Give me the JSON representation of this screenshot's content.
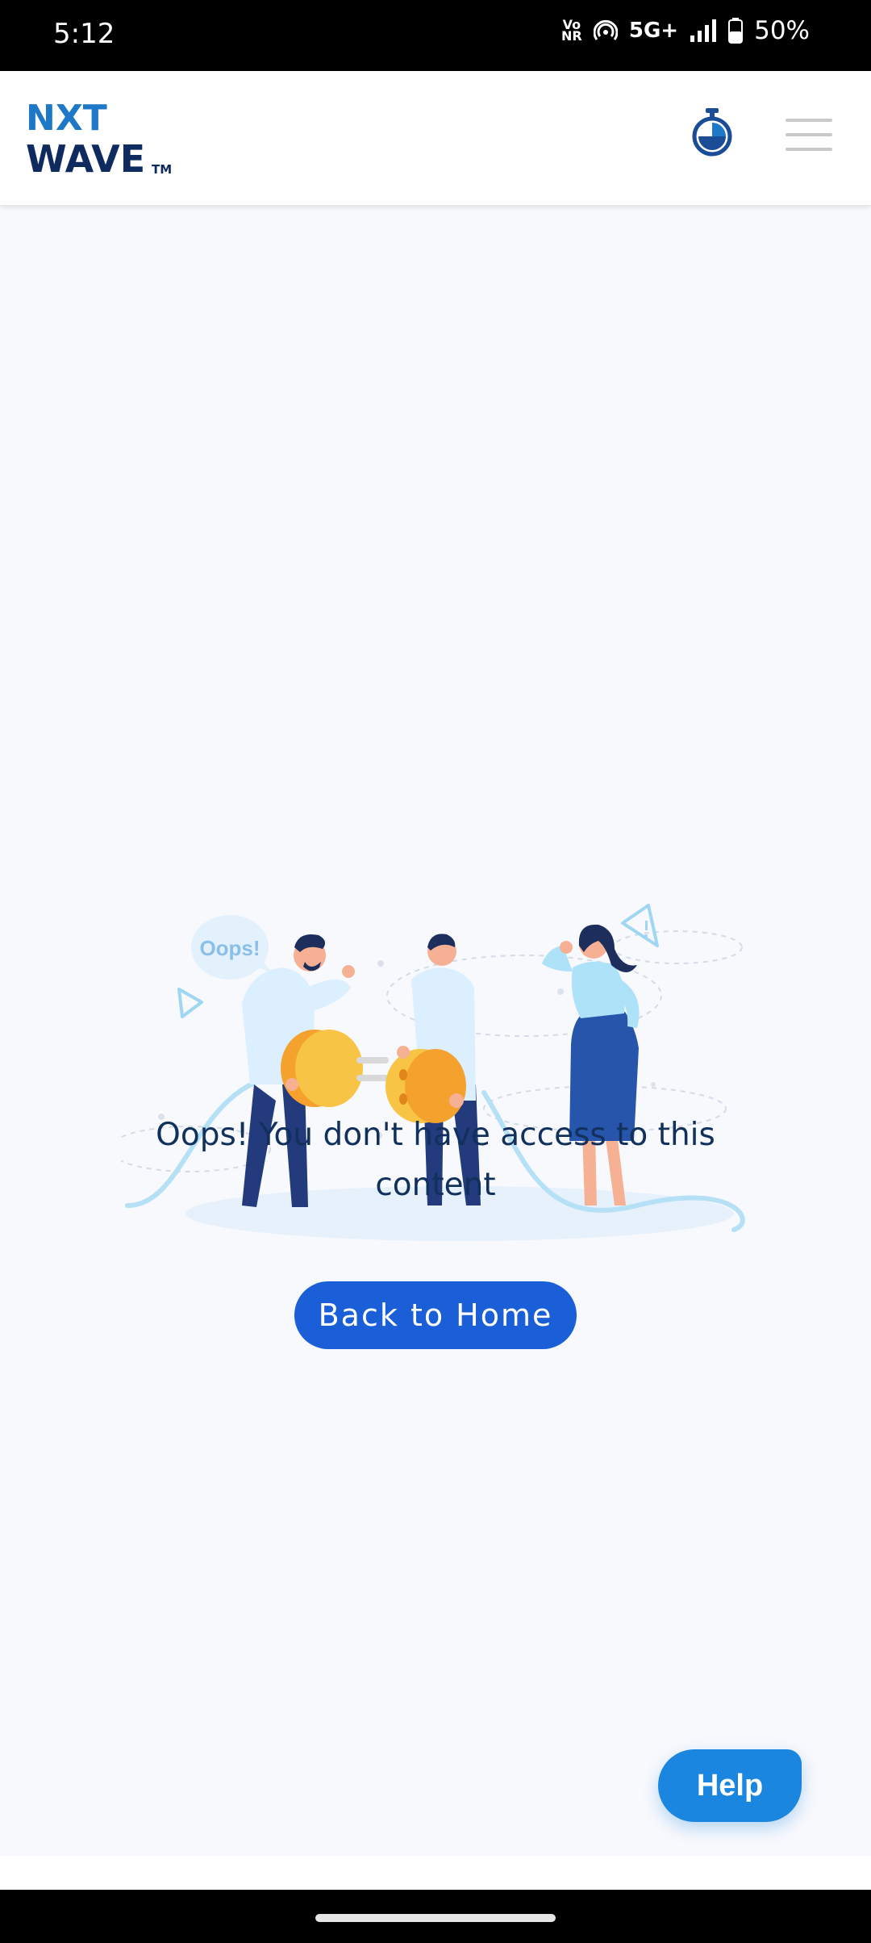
{
  "status_bar": {
    "time": "5:12",
    "network_badge": "Vo NR",
    "network_type": "5G+",
    "battery": "50%"
  },
  "header": {
    "logo_line1": "NXT",
    "logo_line2": "WAVE",
    "logo_tm": "TM",
    "brand_colors": {
      "navy": "#0e2a5e",
      "blue": "#1e78c8"
    },
    "icons": [
      "timer-icon",
      "hamburger-menu-icon"
    ]
  },
  "illustration": {
    "bubble_text": "Oops!"
  },
  "main": {
    "message": "Oops! You don't have access to this content",
    "back_button_label": "Back to Home"
  },
  "help": {
    "label": "Help"
  },
  "colors": {
    "page_bg": "#f8f9fd",
    "button_blue": "#1a5fd8",
    "help_blue": "#1a86e0",
    "text_navy": "#12305c"
  }
}
